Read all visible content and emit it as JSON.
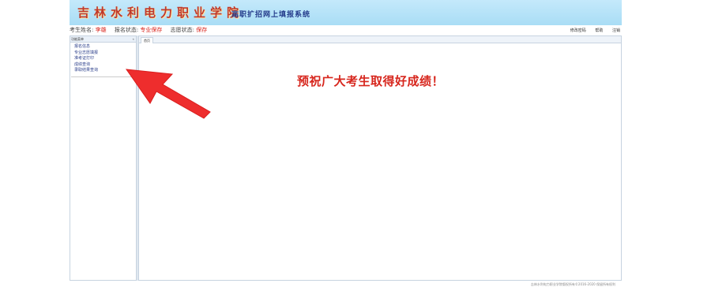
{
  "banner": {
    "school_name": "吉林水利电力职业学院",
    "system_name": "高职扩招网上填报系统"
  },
  "infobar": {
    "name_label": "考生姓名:",
    "name_value": "李雄",
    "status_label": "报名状态:",
    "status_value": "专业保存",
    "wish_label": "志愿状态:",
    "wish_value": "保存",
    "links": [
      "修改密码",
      "帮助",
      "注销"
    ]
  },
  "sidebar": {
    "title": "功能菜单",
    "items": [
      "报名信息",
      "专业志愿填报",
      "准考证打印",
      "成绩查询",
      "录取结果查询"
    ]
  },
  "main": {
    "tab_label": "首页",
    "message": "预祝广大考生取得好成绩！"
  },
  "footer": {
    "copyright": "吉林水利电力职业学院版权所有©2016-2020 保留所有权利"
  },
  "colors": {
    "banner_bg": "#b3e1f7",
    "accent_red": "#d7261d",
    "arrow_red": "#ee2d2d"
  }
}
